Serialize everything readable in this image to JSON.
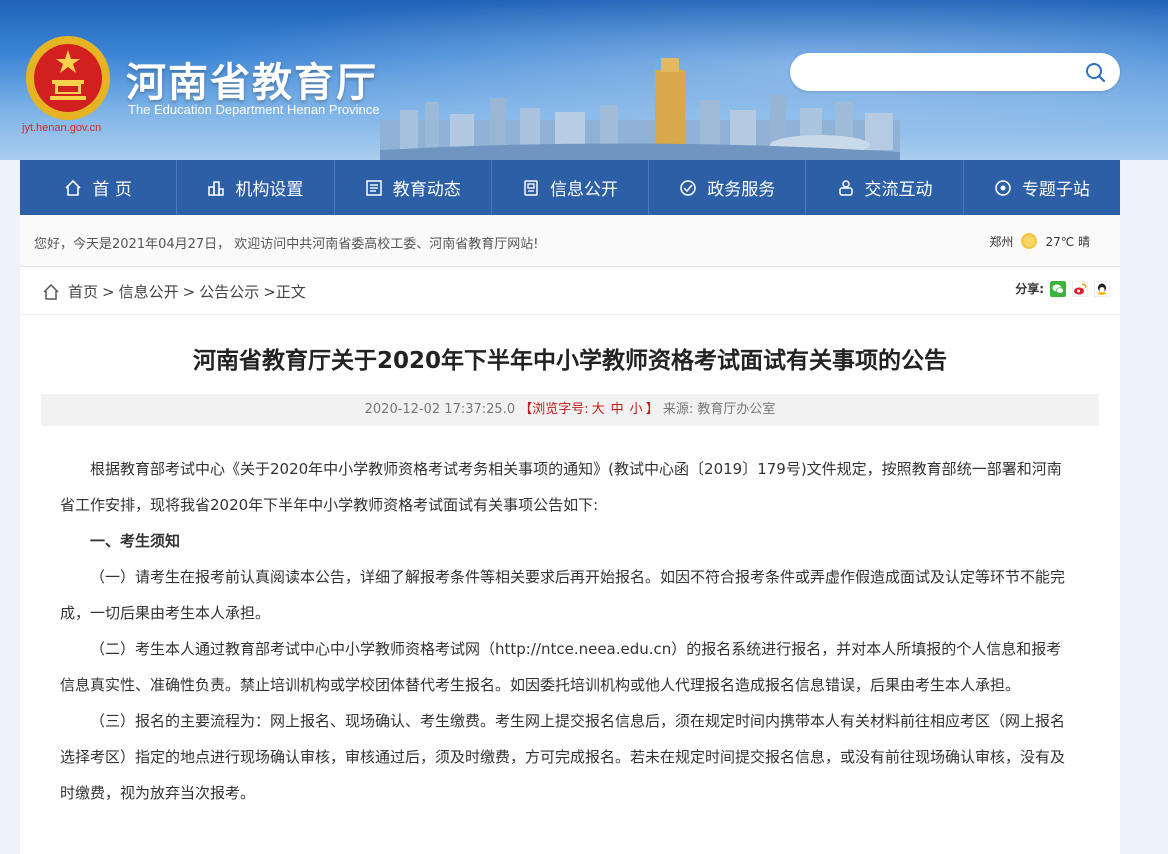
{
  "header": {
    "title_cn": "河南省教育厅",
    "title_en": "The Education Department Henan Province",
    "site_url": "jyt.henan.gov.cn",
    "search_placeholder": ""
  },
  "nav": {
    "items": [
      {
        "label": "首 页",
        "icon": "home-icon"
      },
      {
        "label": "机构设置",
        "icon": "org-icon"
      },
      {
        "label": "教育动态",
        "icon": "news-icon"
      },
      {
        "label": "信息公开",
        "icon": "info-icon"
      },
      {
        "label": "政务服务",
        "icon": "service-icon"
      },
      {
        "label": "交流互动",
        "icon": "interact-icon"
      },
      {
        "label": "专题子站",
        "icon": "subsite-icon"
      }
    ]
  },
  "welcome": {
    "text": "您好，今天是2021年04月27日， 欢迎访问中共河南省委高校工委、河南省教育厅网站!",
    "city": "郑州",
    "temp": "27℃ 晴"
  },
  "breadcrumb": {
    "items": [
      "首页",
      "信息公开",
      "公告公示"
    ],
    "current": ">正文",
    "sep": ">"
  },
  "share": {
    "label": "分享:"
  },
  "article": {
    "title": "河南省教育厅关于2020年下半年中小学教师资格考试面试有关事项的公告",
    "datetime": "2020-12-02 17:37:25.0",
    "fontsize_prefix": "【浏览字号:",
    "size_large": "大",
    "size_mid": "中",
    "size_small": "小",
    "fontsize_suffix": "】",
    "source": "来源: 教育厅办公室",
    "paragraphs": [
      {
        "text": "根据教育部考试中心《关于2020年中小学教师资格考试考务相关事项的通知》(教试中心函〔2019〕179号)文件规定，按照教育部统一部署和河南省工作安排，现将我省2020年下半年中小学教师资格考试面试有关事项公告如下:",
        "heading": false
      },
      {
        "text": "一、考生须知",
        "heading": true
      },
      {
        "text": "（一）请考生在报考前认真阅读本公告，详细了解报考条件等相关要求后再开始报名。如因不符合报考条件或弄虚作假造成面试及认定等环节不能完成，一切后果由考生本人承担。",
        "heading": false
      },
      {
        "text": "（二）考生本人通过教育部考试中心中小学教师资格考试网（http://ntce.neea.edu.cn）的报名系统进行报名，并对本人所填报的个人信息和报考信息真实性、准确性负责。禁止培训机构或学校团体替代考生报名。如因委托培训机构或他人代理报名造成报名信息错误，后果由考生本人承担。",
        "heading": false
      },
      {
        "text": "（三）报名的主要流程为：网上报名、现场确认、考生缴费。考生网上提交报名信息后，须在规定时间内携带本人有关材料前往相应考区（网上报名选择考区）指定的地点进行现场确认审核，审核通过后，须及时缴费，方可完成报名。若未在规定时间提交报名信息，或没有前往现场确认审核，没有及时缴费，视为放弃当次报考。",
        "heading": false
      }
    ]
  },
  "colors": {
    "nav_bg": "#2c5fa5",
    "accent_red": "#c81a1a",
    "brand_red": "#d42b1e"
  }
}
